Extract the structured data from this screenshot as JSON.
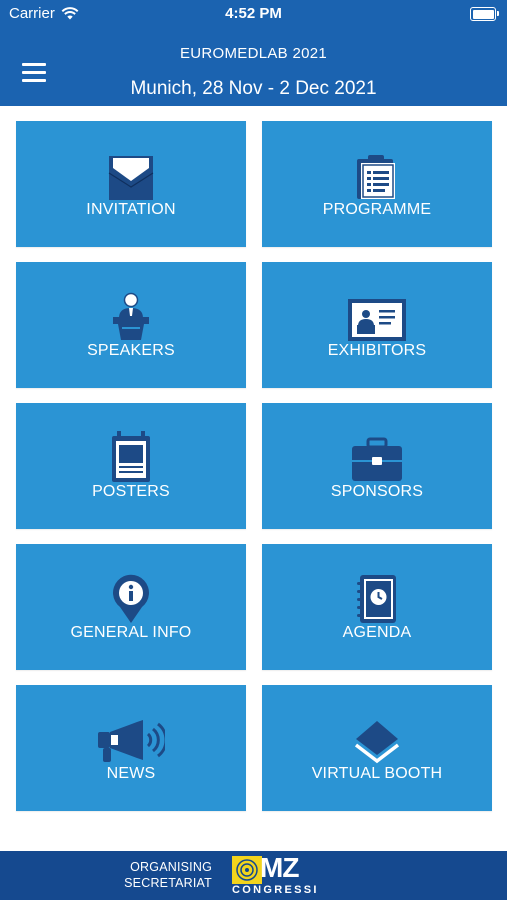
{
  "status_bar": {
    "carrier": "Carrier",
    "time": "4:52 PM"
  },
  "header": {
    "title": "EUROMEDLAB 2021",
    "subtitle": "Munich, 28 Nov - 2 Dec 2021"
  },
  "colors": {
    "header": "#1b63b0",
    "tile": "#2b94d4",
    "footer": "#15498f",
    "icon_dark": "#1d4a86",
    "logo_yellow": "#f2d41d"
  },
  "tiles": [
    {
      "label": "INVITATION",
      "icon": "envelope-icon"
    },
    {
      "label": "PROGRAMME",
      "icon": "clipboard-icon"
    },
    {
      "label": "SPEAKERS",
      "icon": "speaker-podium-icon"
    },
    {
      "label": "EXHIBITORS",
      "icon": "exhibition-stand-icon"
    },
    {
      "label": "POSTERS",
      "icon": "poster-board-icon"
    },
    {
      "label": "SPONSORS",
      "icon": "briefcase-icon"
    },
    {
      "label": "GENERAL INFO",
      "icon": "info-pin-icon"
    },
    {
      "label": "AGENDA",
      "icon": "agenda-book-icon"
    },
    {
      "label": "NEWS",
      "icon": "megaphone-icon"
    },
    {
      "label": "VIRTUAL BOOTH",
      "icon": "layers-icon"
    }
  ],
  "footer": {
    "line1": "ORGANISING",
    "line2": "SECRETARIAT",
    "logo_mz": "MZ",
    "logo_sub": "CONGRESSI"
  }
}
